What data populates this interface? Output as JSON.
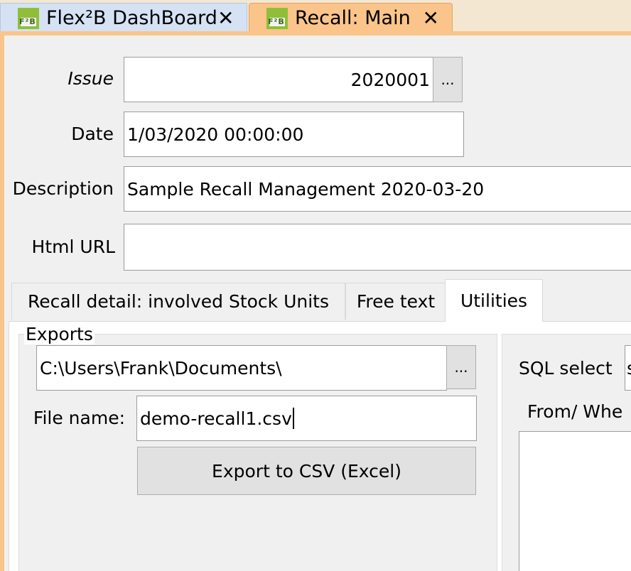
{
  "tabs": [
    {
      "label": "Flex²B DashBoard",
      "logo": "F²B",
      "close": "✕"
    },
    {
      "label": "Recall: Main",
      "logo": "F²B",
      "close": "✕"
    }
  ],
  "form": {
    "issue_label": "Issue",
    "issue_value": "2020001",
    "issue_lookup": "...",
    "date_label": "Date",
    "date_value": "1/03/2020 00:00:00",
    "description_label": "Description",
    "description_value": "Sample Recall Management 2020-03-20",
    "html_url_label": "Html URL",
    "html_url_value": ""
  },
  "inner_tabs": [
    {
      "label": "Recall detail: involved Stock Units"
    },
    {
      "label": "Free text"
    },
    {
      "label": "Utilities"
    }
  ],
  "exports": {
    "group_label": "Exports",
    "folder_value": "C:\\Users\\Frank\\Documents\\",
    "folder_browse": "...",
    "filename_label": "File name:",
    "filename_value": "demo-recall1.csv",
    "export_button": "Export to CSV (Excel)"
  },
  "sql": {
    "select_label": "SQL select",
    "select_value": "s",
    "from_where_label": "From/ Whe"
  },
  "colors": {
    "active_tab": "#fbc48a",
    "inactive_tab": "#d4e2f4",
    "logo_green": "#8fbf3a"
  }
}
